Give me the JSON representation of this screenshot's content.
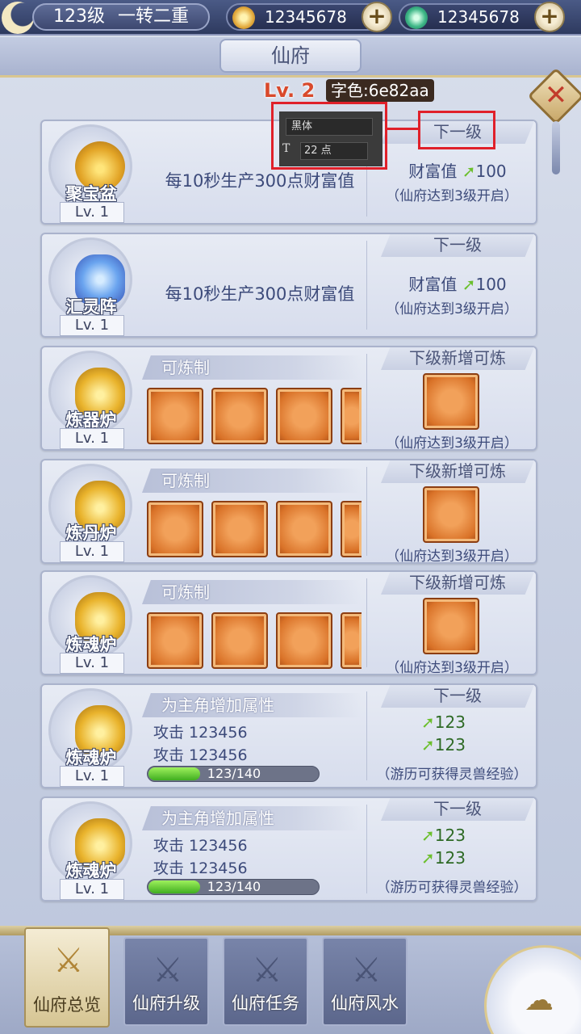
{
  "header": {
    "level": "123级",
    "realm": "一转二重",
    "gold_amount": "12345678",
    "jade_amount": "12345678",
    "gold_icon": "coin-icon",
    "jade_icon": "jade-icon",
    "plus_label": "+"
  },
  "title": "仙府",
  "close_label": "✕",
  "annotation": {
    "level_text": "Lv. 2",
    "color_text": "字色:6e82aa",
    "font_name": "黑体",
    "font_size": "22 点",
    "tt_glyph": "T"
  },
  "cards": [
    {
      "name": "聚宝盆",
      "lv": "Lv. 1",
      "desc": "每10秒生产300点财富值",
      "right_head": "下一级",
      "wealth_label": "财富值",
      "wealth_value": "100",
      "note": "（仙府达到3级开启）"
    },
    {
      "name": "汇灵阵",
      "lv": "Lv. 1",
      "desc": "每10秒生产300点财富值",
      "right_head": "下一级",
      "wealth_label": "财富值",
      "wealth_value": "100",
      "note": "（仙府达到3级开启）"
    },
    {
      "name": "炼器炉",
      "lv": "Lv. 1",
      "craft_head": "可炼制",
      "right_head": "下级新增可炼",
      "note": "（仙府达到3级开启）"
    },
    {
      "name": "炼丹炉",
      "lv": "Lv. 1",
      "craft_head": "可炼制",
      "right_head": "下级新增可炼",
      "note": "（仙府达到3级开启）"
    },
    {
      "name": "炼魂炉",
      "lv": "Lv. 1",
      "craft_head": "可炼制",
      "right_head": "下级新增可炼",
      "note": "（仙府达到3级开启）"
    },
    {
      "name": "炼魂炉",
      "lv": "Lv. 1",
      "craft_head": "为主角增加属性",
      "attr1": "攻击 123456",
      "attr2": "攻击 123456",
      "progress_text": "123/140",
      "progress": 0.3,
      "right_head": "下一级",
      "gain1": "123",
      "gain2": "123",
      "note": "（游历可获得灵兽经验）"
    },
    {
      "name": "炼魂炉",
      "lv": "Lv. 1",
      "craft_head": "为主角增加属性",
      "attr1": "攻击 123456",
      "attr2": "攻击 123456",
      "progress_text": "123/140",
      "progress": 0.3,
      "right_head": "下一级",
      "gain1": "123",
      "gain2": "123",
      "note": "（游历可获得灵兽经验）"
    }
  ],
  "arrow_glyph": "➚",
  "tabs": [
    {
      "label": "仙府总览",
      "icon": "crossed-swords-icon",
      "active": true
    },
    {
      "label": "仙府升级",
      "icon": "crossed-swords-icon",
      "active": false
    },
    {
      "label": "仙府任务",
      "icon": "crossed-swords-icon",
      "active": false
    },
    {
      "label": "仙府风水",
      "icon": "crossed-swords-icon",
      "active": false
    }
  ],
  "tab_icon_glyph": "⚔",
  "orb_icon": "cloud-icon",
  "orb_glyph": "☁"
}
